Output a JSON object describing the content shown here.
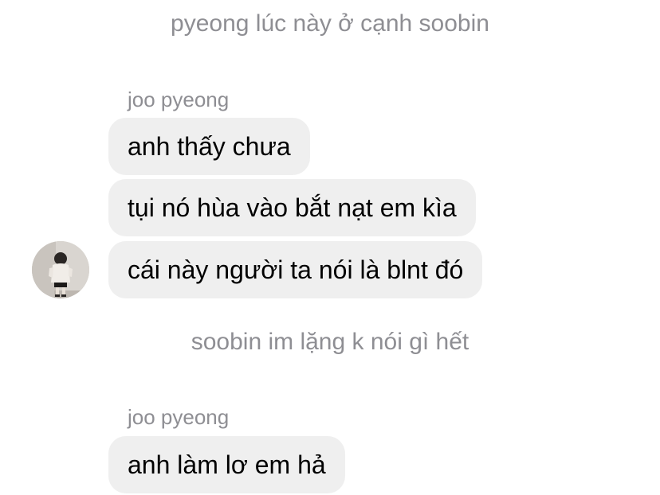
{
  "thread": {
    "note_top": "pyeong lúc này ở cạnh soobin",
    "group1": {
      "sender": "joo pyeong",
      "messages": [
        "anh thấy chưa",
        "tụi nó hùa vào bắt nạt em kìa",
        "cái này người ta nói là blnt đó"
      ]
    },
    "note_middle": "soobin im lặng k nói gì hết",
    "group2": {
      "sender": "joo pyeong",
      "messages": [
        "anh làm lơ em hả"
      ]
    }
  },
  "colors": {
    "bubble_bg": "#efefef",
    "meta_text": "#8e8e93",
    "message_text": "#000000",
    "background": "#ffffff"
  },
  "icons": {
    "avatar": "avatar-photo-person"
  }
}
